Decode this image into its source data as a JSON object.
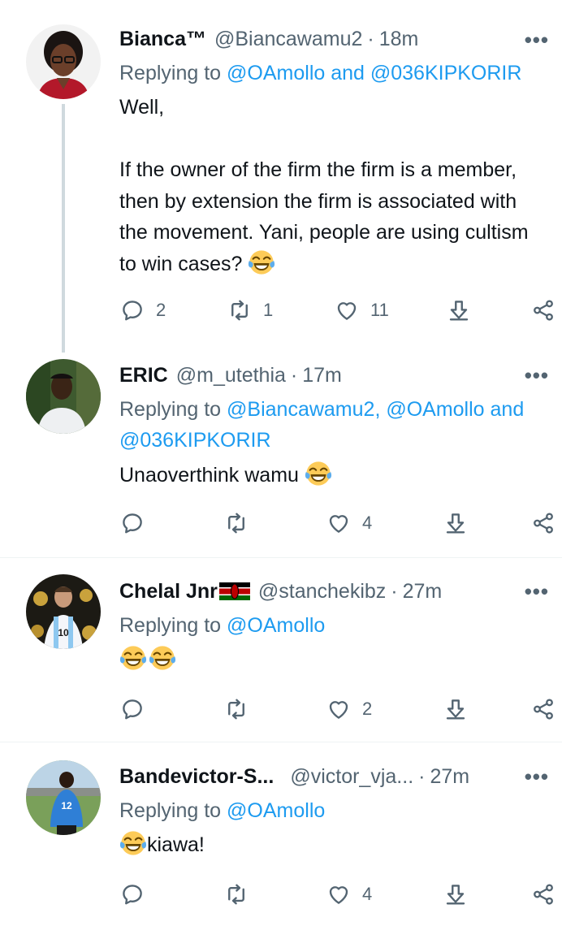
{
  "tweets": [
    {
      "name": "Bianca™",
      "handle": "@Biancawamu2",
      "sep": "·",
      "time": "18m",
      "reply_prefix": "Replying to ",
      "reply_mentions": "@OAmollo and @036KIPKORIR",
      "text": "Well,\n\nIf the owner of the firm the firm is a member, then by extension the firm is associated with the movement. Yani, people are using cultism to win cases? ",
      "emojis": [
        "face-with-tears-of-joy"
      ],
      "counts": {
        "replies": "2",
        "retweets": "1",
        "likes": "11"
      }
    },
    {
      "name": "ERIC",
      "handle": "@m_utethia",
      "sep": "·",
      "time": "17m",
      "reply_prefix": "Replying to ",
      "reply_mentions": "@Biancawamu2, @OAmollo and @036KIPKORIR",
      "text": "Unaoverthink wamu ",
      "emojis": [
        "face-with-tears-of-joy"
      ],
      "counts": {
        "replies": "",
        "retweets": "",
        "likes": "4"
      }
    },
    {
      "name": "Chelal Jnr",
      "flag": "kenya-flag",
      "handle": "@stanchekibz",
      "sep": "·",
      "time": "27m",
      "reply_prefix": "Replying to ",
      "reply_mentions": "@OAmollo",
      "text": "",
      "emojis": [
        "face-with-tears-of-joy",
        "face-with-tears-of-joy"
      ],
      "counts": {
        "replies": "",
        "retweets": "",
        "likes": "2"
      }
    },
    {
      "name": "Bandevictor-S...",
      "handle": "@victor_vja...",
      "sep": "·",
      "time": "27m",
      "reply_prefix": "Replying to ",
      "reply_mentions": "@OAmollo",
      "text": "kiawa!",
      "emojis": [
        "face-with-tears-of-joy"
      ],
      "counts": {
        "replies": "",
        "retweets": "",
        "likes": "4"
      }
    }
  ],
  "more_label": "•••",
  "colors": {
    "link": "#1d9bf0",
    "secondary": "#536471",
    "text": "#0f1419",
    "divider": "#eff3f4"
  },
  "icons": [
    "reply-icon",
    "retweet-icon",
    "like-icon",
    "download-icon",
    "share-icon",
    "more-icon"
  ]
}
